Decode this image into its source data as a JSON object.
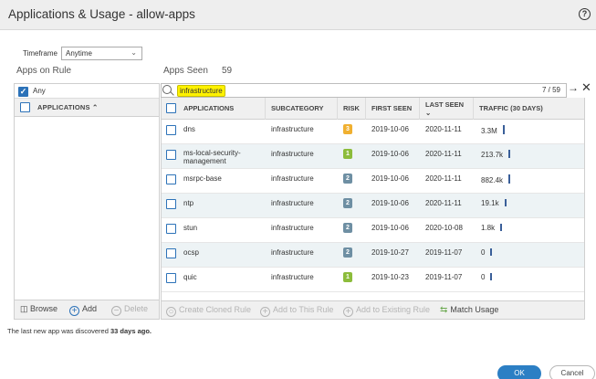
{
  "dialog": {
    "title": "Applications & Usage - allow-apps",
    "help_icon": "?"
  },
  "timeframe": {
    "label": "Timeframe",
    "selected": "Anytime"
  },
  "panels": {
    "apps_on_rule_label": "Apps on Rule",
    "apps_seen_label": "Apps Seen",
    "apps_seen_count": "59"
  },
  "left_panel": {
    "any_label": "Any",
    "any_checked": true,
    "header": "APPLICATIONS",
    "footer": {
      "browse": "Browse",
      "add": "Add",
      "delete": "Delete"
    }
  },
  "search": {
    "value": "infrastructure",
    "count": "7 / 59"
  },
  "table": {
    "columns": [
      "APPLICATIONS",
      "SUBCATEGORY",
      "RISK",
      "FIRST SEEN",
      "LAST SEEN",
      "TRAFFIC (30 DAYS)"
    ],
    "rows": [
      {
        "app": "dns",
        "subcategory": "infrastructure",
        "risk": "3",
        "first_seen": "2019-10-06",
        "last_seen": "2020-11-11",
        "traffic": "3.3M",
        "traffic_level": 1.0
      },
      {
        "app": "ms-local-security-management",
        "app_line1": "ms-local-security-",
        "app_line2": "management",
        "subcategory": "infrastructure",
        "risk": "1",
        "first_seen": "2019-10-06",
        "last_seen": "2020-11-11",
        "traffic": "213.7k",
        "traffic_level": 0.9
      },
      {
        "app": "msrpc-base",
        "subcategory": "infrastructure",
        "risk": "2",
        "first_seen": "2019-10-06",
        "last_seen": "2020-11-11",
        "traffic": "882.4k",
        "traffic_level": 1.0
      },
      {
        "app": "ntp",
        "subcategory": "infrastructure",
        "risk": "2",
        "first_seen": "2019-10-06",
        "last_seen": "2020-11-11",
        "traffic": "19.1k",
        "traffic_level": 0.8
      },
      {
        "app": "stun",
        "subcategory": "infrastructure",
        "risk": "2",
        "first_seen": "2019-10-06",
        "last_seen": "2020-10-08",
        "traffic": "1.8k",
        "traffic_level": 0.8
      },
      {
        "app": "ocsp",
        "subcategory": "infrastructure",
        "risk": "2",
        "first_seen": "2019-10-27",
        "last_seen": "2019-11-07",
        "traffic": "0",
        "traffic_level": 0.8
      },
      {
        "app": "quic",
        "subcategory": "infrastructure",
        "risk": "1",
        "first_seen": "2019-10-23",
        "last_seen": "2019-11-07",
        "traffic": "0",
        "traffic_level": 0.8
      }
    ]
  },
  "table_actions": {
    "create_cloned_rule": "Create Cloned Rule",
    "add_to_this_rule": "Add to This Rule",
    "add_to_existing_rule": "Add to Existing Rule",
    "match_usage": "Match Usage"
  },
  "status": {
    "prefix": "The last new app was discovered ",
    "emphasis": "33 days ago."
  },
  "buttons": {
    "ok": "OK",
    "cancel": "Cancel"
  },
  "colors": {
    "accent": "#2c7fc4",
    "risk_1": "#8cbc3b",
    "risk_2": "#6e8fa3",
    "risk_3": "#f0b030",
    "search_highlight": "#fff200"
  }
}
